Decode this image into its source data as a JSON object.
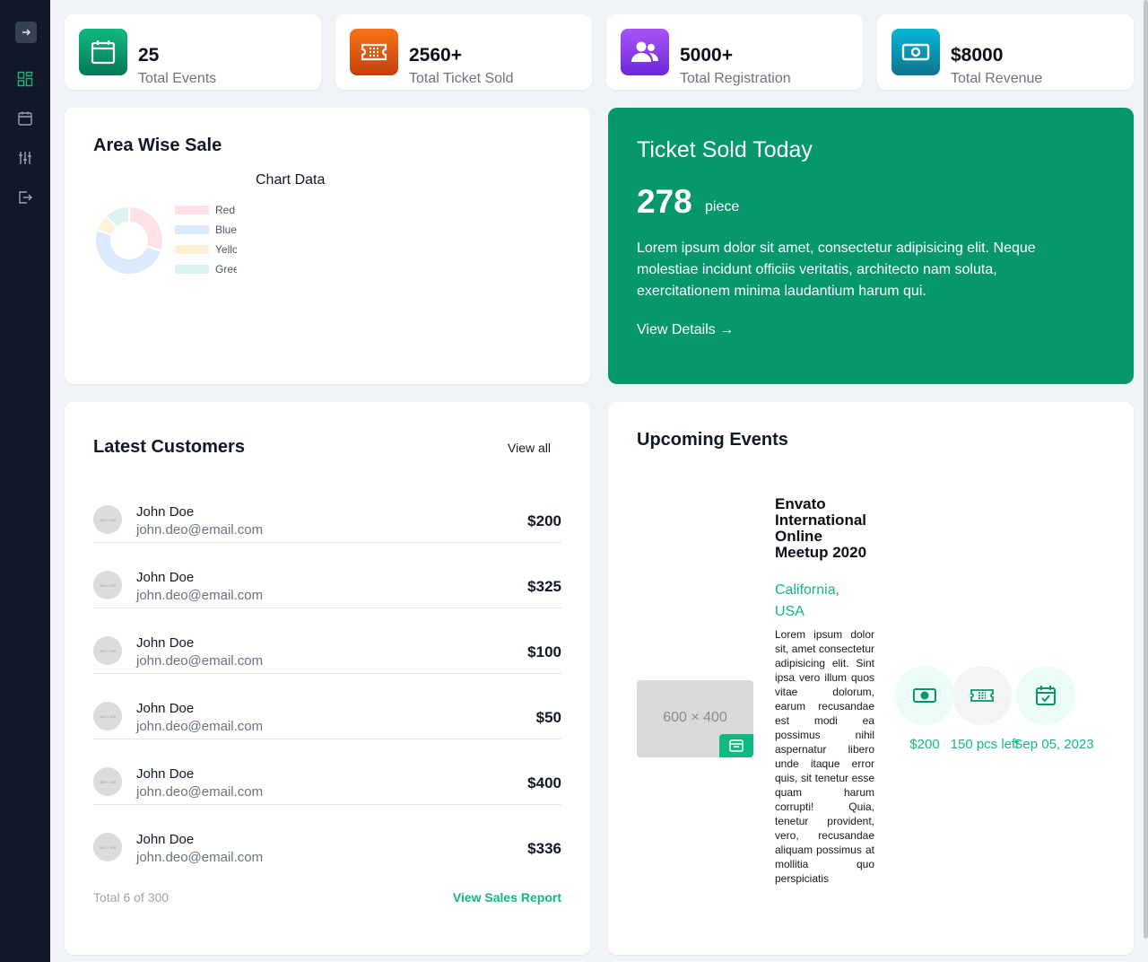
{
  "stats": [
    {
      "value": "25",
      "label": "Total Events",
      "icon": "calendar-icon",
      "color": "#059669"
    },
    {
      "value": "2560+",
      "label": "Total Ticket Sold",
      "icon": "ticket-icon",
      "color": "#ea580c"
    },
    {
      "value": "5000+",
      "label": "Total Registration",
      "icon": "users-icon",
      "color": "#7c3aed"
    },
    {
      "value": "$8000",
      "label": "Total Revenue",
      "icon": "money-icon",
      "color": "#0891b2"
    }
  ],
  "area": {
    "title": "Area Wise Sale",
    "chart_data": {
      "type": "pie",
      "title": "Chart Data",
      "categories": [
        "Red",
        "Blue",
        "Yellow",
        "Green"
      ],
      "values": [
        30,
        50,
        8,
        12
      ],
      "colors": [
        "#ffe1e6",
        "#dbeafe",
        "#fff1d6",
        "#dcf3f2"
      ],
      "legend": "right"
    }
  },
  "today": {
    "title": "Ticket Sold Today",
    "value": "278",
    "unit": "piece",
    "description": "Lorem ipsum dolor sit amet, consectetur adipisicing elit. Neque molestiae incidunt officiis veritatis, architecto nam soluta, exercitationem minima laudantium harum qui.",
    "link": "View Details →"
  },
  "customers": {
    "title": "Latest Customers",
    "view_all": "View all",
    "avatar_placeholder": "100 × 100",
    "rows": [
      {
        "name": "John Doe",
        "email": "john.deo@email.com",
        "amount": "$200"
      },
      {
        "name": "John Doe",
        "email": "john.deo@email.com",
        "amount": "$325"
      },
      {
        "name": "John Doe",
        "email": "john.deo@email.com",
        "amount": "$100"
      },
      {
        "name": "John Doe",
        "email": "john.deo@email.com",
        "amount": "$50"
      },
      {
        "name": "John Doe",
        "email": "john.deo@email.com",
        "amount": "$400"
      },
      {
        "name": "John Doe",
        "email": "john.deo@email.com",
        "amount": "$336"
      }
    ],
    "footer_total": "Total 6 of 300",
    "footer_link": "View Sales Report"
  },
  "events": {
    "title": "Upcoming Events",
    "image_placeholder": "600 × 400",
    "event": {
      "title": "Envato International Online Meetup 2020",
      "location": "California, USA",
      "description": "Lorem ipsum dolor sit, amet consectetur adipisicing elit. Sint ipsa vero illum quos vitae dolorum, earum recusandae est modi ea possimus nihil aspernatur libero unde itaque error quis, sit tenetur esse quam harum corrupti! Quia, tenetur provident, vero, recusandae aliquam possimus at mollitia quo perspiciatis",
      "price": "$200",
      "tickets_left": "150 pcs left",
      "date": "Sep 05, 2023"
    }
  },
  "colors": {
    "sidebar": "#111827",
    "accent": "#10b981",
    "highlight": "#06986b"
  }
}
